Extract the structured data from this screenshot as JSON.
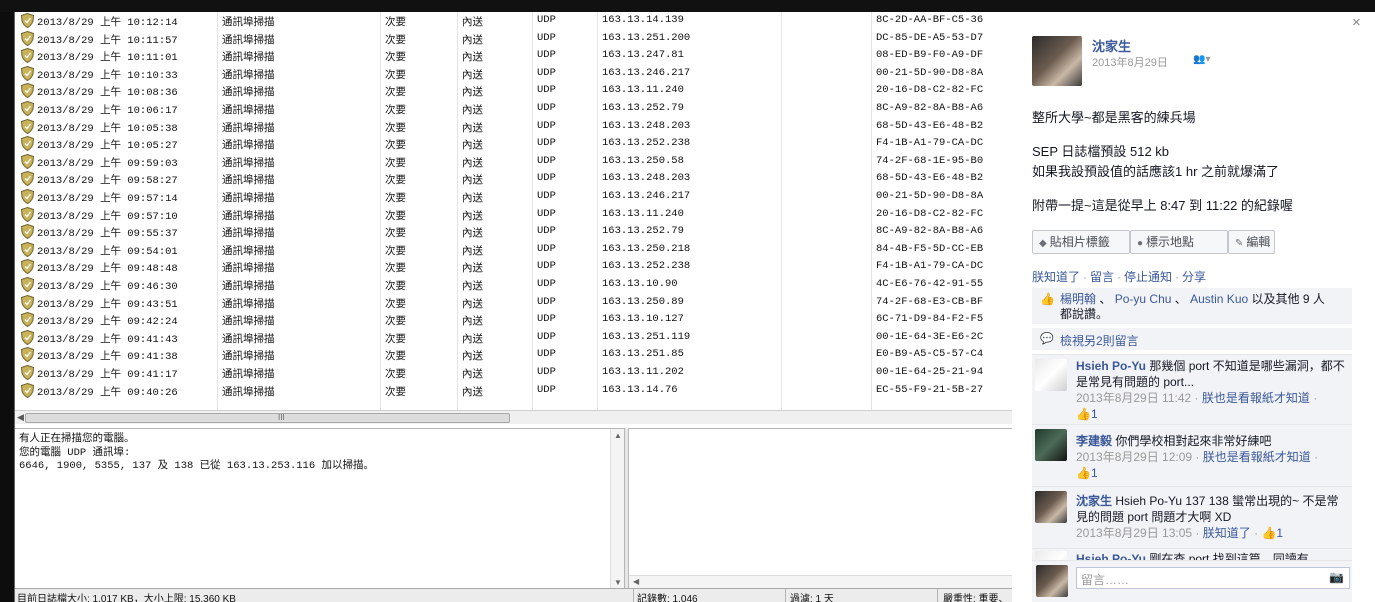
{
  "log": {
    "rows": [
      {
        "date": "2013/8/29 上午 10:12:14",
        "event": "通訊埠掃描",
        "severity": "次要",
        "direction": "內送",
        "protocol": "UDP",
        "ip": "163.13.14.139",
        "mac": "8C-2D-AA-BF-C5-36"
      },
      {
        "date": "2013/8/29 上午 10:11:57",
        "event": "通訊埠掃描",
        "severity": "次要",
        "direction": "內送",
        "protocol": "UDP",
        "ip": "163.13.251.200",
        "mac": "DC-85-DE-A5-53-D7"
      },
      {
        "date": "2013/8/29 上午 10:11:01",
        "event": "通訊埠掃描",
        "severity": "次要",
        "direction": "內送",
        "protocol": "UDP",
        "ip": "163.13.247.81",
        "mac": "08-ED-B9-F0-A9-DF"
      },
      {
        "date": "2013/8/29 上午 10:10:33",
        "event": "通訊埠掃描",
        "severity": "次要",
        "direction": "內送",
        "protocol": "UDP",
        "ip": "163.13.246.217",
        "mac": "00-21-5D-90-D8-8A"
      },
      {
        "date": "2013/8/29 上午 10:08:36",
        "event": "通訊埠掃描",
        "severity": "次要",
        "direction": "內送",
        "protocol": "UDP",
        "ip": "163.13.11.240",
        "mac": "20-16-D8-C2-82-FC"
      },
      {
        "date": "2013/8/29 上午 10:06:17",
        "event": "通訊埠掃描",
        "severity": "次要",
        "direction": "內送",
        "protocol": "UDP",
        "ip": "163.13.252.79",
        "mac": "8C-A9-82-8A-B8-A6"
      },
      {
        "date": "2013/8/29 上午 10:05:38",
        "event": "通訊埠掃描",
        "severity": "次要",
        "direction": "內送",
        "protocol": "UDP",
        "ip": "163.13.248.203",
        "mac": "68-5D-43-E6-48-B2"
      },
      {
        "date": "2013/8/29 上午 10:05:27",
        "event": "通訊埠掃描",
        "severity": "次要",
        "direction": "內送",
        "protocol": "UDP",
        "ip": "163.13.252.238",
        "mac": "F4-1B-A1-79-CA-DC"
      },
      {
        "date": "2013/8/29 上午 09:59:03",
        "event": "通訊埠掃描",
        "severity": "次要",
        "direction": "內送",
        "protocol": "UDP",
        "ip": "163.13.250.58",
        "mac": "74-2F-68-1E-95-B0"
      },
      {
        "date": "2013/8/29 上午 09:58:27",
        "event": "通訊埠掃描",
        "severity": "次要",
        "direction": "內送",
        "protocol": "UDP",
        "ip": "163.13.248.203",
        "mac": "68-5D-43-E6-48-B2"
      },
      {
        "date": "2013/8/29 上午 09:57:14",
        "event": "通訊埠掃描",
        "severity": "次要",
        "direction": "內送",
        "protocol": "UDP",
        "ip": "163.13.246.217",
        "mac": "00-21-5D-90-D8-8A"
      },
      {
        "date": "2013/8/29 上午 09:57:10",
        "event": "通訊埠掃描",
        "severity": "次要",
        "direction": "內送",
        "protocol": "UDP",
        "ip": "163.13.11.240",
        "mac": "20-16-D8-C2-82-FC"
      },
      {
        "date": "2013/8/29 上午 09:55:37",
        "event": "通訊埠掃描",
        "severity": "次要",
        "direction": "內送",
        "protocol": "UDP",
        "ip": "163.13.252.79",
        "mac": "8C-A9-82-8A-B8-A6"
      },
      {
        "date": "2013/8/29 上午 09:54:01",
        "event": "通訊埠掃描",
        "severity": "次要",
        "direction": "內送",
        "protocol": "UDP",
        "ip": "163.13.250.218",
        "mac": "84-4B-F5-5D-CC-EB"
      },
      {
        "date": "2013/8/29 上午 09:48:48",
        "event": "通訊埠掃描",
        "severity": "次要",
        "direction": "內送",
        "protocol": "UDP",
        "ip": "163.13.252.238",
        "mac": "F4-1B-A1-79-CA-DC"
      },
      {
        "date": "2013/8/29 上午 09:46:30",
        "event": "通訊埠掃描",
        "severity": "次要",
        "direction": "內送",
        "protocol": "UDP",
        "ip": "163.13.10.90",
        "mac": "4C-E6-76-42-91-55"
      },
      {
        "date": "2013/8/29 上午 09:43:51",
        "event": "通訊埠掃描",
        "severity": "次要",
        "direction": "內送",
        "protocol": "UDP",
        "ip": "163.13.250.89",
        "mac": "74-2F-68-E3-CB-BF"
      },
      {
        "date": "2013/8/29 上午 09:42:24",
        "event": "通訊埠掃描",
        "severity": "次要",
        "direction": "內送",
        "protocol": "UDP",
        "ip": "163.13.10.127",
        "mac": "6C-71-D9-84-F2-F5"
      },
      {
        "date": "2013/8/29 上午 09:41:43",
        "event": "通訊埠掃描",
        "severity": "次要",
        "direction": "內送",
        "protocol": "UDP",
        "ip": "163.13.251.119",
        "mac": "00-1E-64-3E-E6-2C"
      },
      {
        "date": "2013/8/29 上午 09:41:38",
        "event": "通訊埠掃描",
        "severity": "次要",
        "direction": "內送",
        "protocol": "UDP",
        "ip": "163.13.251.85",
        "mac": "E0-B9-A5-C5-57-C4"
      },
      {
        "date": "2013/8/29 上午 09:41:17",
        "event": "通訊埠掃描",
        "severity": "次要",
        "direction": "內送",
        "protocol": "UDP",
        "ip": "163.13.11.202",
        "mac": "00-1E-64-25-21-94"
      },
      {
        "date": "2013/8/29 上午 09:40:26",
        "event": "通訊埠掃描",
        "severity": "次要",
        "direction": "內送",
        "protocol": "UDP",
        "ip": "163.13.14.76",
        "mac": "EC-55-F9-21-5B-27"
      }
    ],
    "scroll_grip": "III",
    "detail_lines": [
      "有人正在掃描您的電腦。",
      "您的電腦 UDP 通訊埠:",
      "6646, 1900, 5355, 137 及 138 已從 163.13.253.116 加以掃描。"
    ],
    "status": {
      "log_size": "目前日誌檔大小: 1,017 KB，大小上限: 15,360 KB",
      "records": "記錄數: 1,046",
      "filter": "過濾: 1 天",
      "severity": "嚴重性: 重要、"
    },
    "colors": {
      "shield": "#c8b25a"
    }
  },
  "fb": {
    "close": "×",
    "author": "沈家生",
    "date": "2013年8月29日",
    "post_lines": [
      "整所大學~都是黑客的練兵場",
      "SEP 日誌檔預設 512 kb",
      "如果我設預設值的話應該1 hr 之前就爆滿了",
      "附帶一提~這是從早上 8:47 到 11:22 的紀錄喔"
    ],
    "buttons": {
      "tag": "貼相片標籤",
      "location": "標示地點",
      "edit": "編輯"
    },
    "actions": {
      "like": "朕知道了",
      "comment": "留言",
      "stop": "停止通知",
      "share": "分享"
    },
    "likes": {
      "names": [
        "楊明翰",
        "Po-yu Chu",
        "Austin Kuo"
      ],
      "sep": "、",
      "others": "以及其他 9 人",
      "suffix": "都說讚。"
    },
    "view_more": "檢視另2則留言",
    "comments": [
      {
        "author": "Hsieh Po-Yu",
        "text": "那幾個 port 不知道是哪些漏洞，都不是常見有問題的 port...",
        "time": "2013年8月29日 11:42",
        "action": "朕也是看報紙才知道",
        "likes": "1"
      },
      {
        "author": "李建毅",
        "text": "你們學校相對起來非常好練吧",
        "time": "2013年8月29日 12:09",
        "action": "朕也是看報紙才知道",
        "likes": "1"
      },
      {
        "author": "沈家生",
        "text": "Hsieh Po-Yu 137 138 蠻常出現的~ 不是常見的問題 port 問題才大啊 XD",
        "time": "2013年8月29日 13:05",
        "action": "朕知道了",
        "likes": "1"
      },
      {
        "author": "Hsieh Po-Yu",
        "text": "剛在查 port 找到這篇，同讀有"
      }
    ],
    "comment_placeholder": "留言……",
    "colors": {
      "link": "#3b5998",
      "ufi_bg": "#f2f3f7"
    }
  }
}
